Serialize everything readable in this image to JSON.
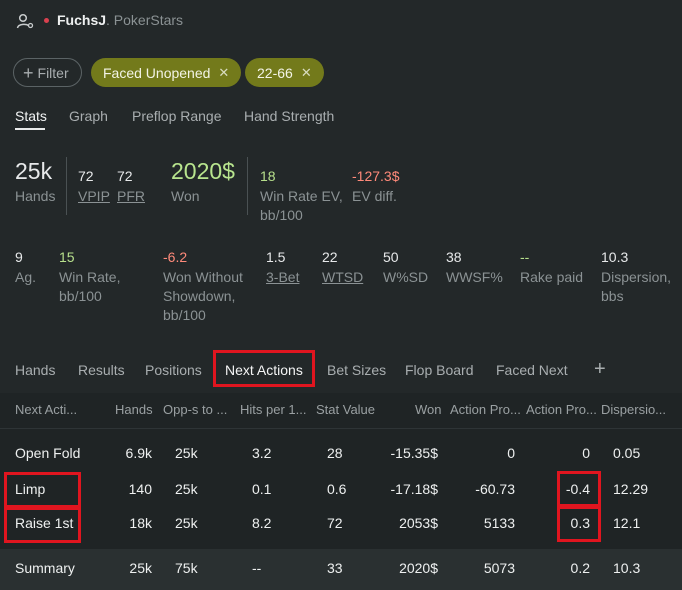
{
  "header": {
    "player_name": "FuchsJ",
    "site": "PokerStars",
    "separator": "."
  },
  "filters": {
    "add_label": "Filter",
    "chips": [
      {
        "label": "Faced Unopened"
      },
      {
        "label": "22-66"
      }
    ]
  },
  "tabs": [
    "Stats",
    "Graph",
    "Preflop Range",
    "Hand Strength"
  ],
  "stats_top": {
    "hands": {
      "value": "25k",
      "label": "Hands"
    },
    "vpip": {
      "value": "72",
      "label": "VPIP"
    },
    "pfr": {
      "value": "72",
      "label": "PFR"
    },
    "won": {
      "value": "2020$",
      "label": "Won"
    },
    "winrate_ev": {
      "value": "18",
      "label_line1": "Win Rate EV,",
      "label_line2": "bb/100"
    },
    "ev_diff": {
      "value": "-127.3$",
      "label": "EV diff."
    }
  },
  "stats_second": {
    "ag": {
      "value": "9",
      "label": "Ag."
    },
    "winrate": {
      "value": "15",
      "label_line1": "Win Rate,",
      "label_line2": "bb/100"
    },
    "wwsd": {
      "value": "-6.2",
      "label_line1": "Won Without",
      "label_line2": "Showdown,",
      "label_line3": "bb/100"
    },
    "threebet": {
      "value": "1.5",
      "label": "3-Bet"
    },
    "wtsd": {
      "value": "22",
      "label": "WTSD"
    },
    "wsd": {
      "value": "50",
      "label": "W%SD"
    },
    "wwsf": {
      "value": "38",
      "label": "WWSF%"
    },
    "rake": {
      "value": "--",
      "label": "Rake paid"
    },
    "dispersion": {
      "value": "10.3",
      "label_line1": "Dispersion,",
      "label_line2": "bbs"
    }
  },
  "lower_tabs": [
    "Hands",
    "Results",
    "Positions",
    "Next Actions",
    "Bet Sizes",
    "Flop Board",
    "Faced Next",
    "+"
  ],
  "table": {
    "headers": [
      "Next Acti...",
      "Hands",
      "Opp-s to ...",
      "Hits per 1...",
      "Stat Value",
      "Won",
      "Action Pro...",
      "Action Pro...",
      "Dispersio..."
    ],
    "rows": [
      {
        "action": "Open Fold",
        "hands": "6.9k",
        "opps": "25k",
        "hits": "3.2",
        "stat": "28",
        "won": "-15.35$",
        "ap1": "0",
        "ap2": "0",
        "disp": "0.05"
      },
      {
        "action": "Limp",
        "hands": "140",
        "opps": "25k",
        "hits": "0.1",
        "stat": "0.6",
        "won": "-17.18$",
        "ap1": "-60.73",
        "ap2": "-0.4",
        "disp": "12.29"
      },
      {
        "action": "Raise 1st",
        "hands": "18k",
        "opps": "25k",
        "hits": "8.2",
        "stat": "72",
        "won": "2053$",
        "ap1": "5133",
        "ap2": "0.3",
        "disp": "12.1"
      }
    ],
    "summary": {
      "action": "Summary",
      "hands": "25k",
      "opps": "75k",
      "hits": "--",
      "stat": "33",
      "won": "2020$",
      "ap1": "5073",
      "ap2": "0.2",
      "disp": "10.3"
    }
  }
}
